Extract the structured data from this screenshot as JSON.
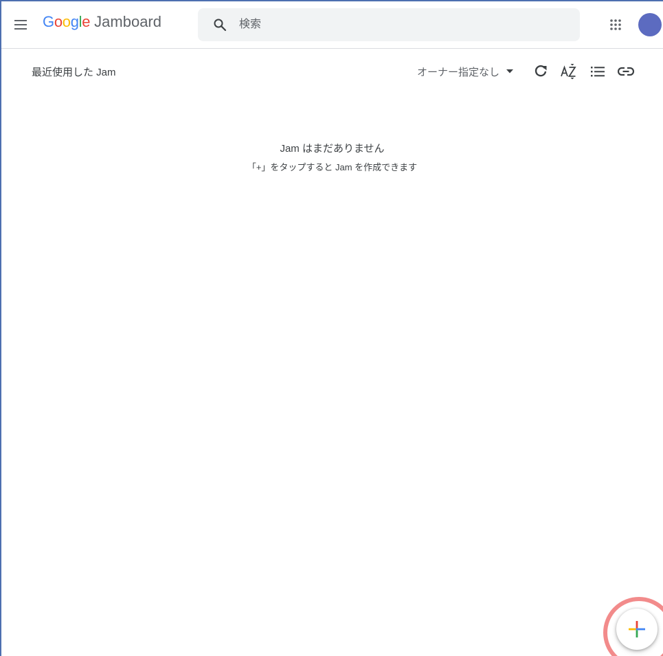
{
  "header": {
    "logo": {
      "letters": [
        {
          "char": "G",
          "color": "#4285F4"
        },
        {
          "char": "o",
          "color": "#EA4335"
        },
        {
          "char": "o",
          "color": "#FBBC05"
        },
        {
          "char": "g",
          "color": "#4285F4"
        },
        {
          "char": "l",
          "color": "#34A853"
        },
        {
          "char": "e",
          "color": "#EA4335"
        }
      ],
      "product": "Jamboard"
    },
    "search": {
      "placeholder": "検索",
      "value": ""
    },
    "icons": {
      "menu": "hamburger-menu-icon",
      "search": "search-icon",
      "apps": "apps-grid-icon"
    },
    "avatar_color": "#5c6bc0"
  },
  "toolbar": {
    "section_title": "最近使用した Jam",
    "owner_filter": "オーナー指定なし",
    "icons": [
      "dropdown-caret-icon",
      "refresh-icon",
      "sort-az-icon",
      "list-view-icon",
      "link-icon"
    ]
  },
  "empty_state": {
    "title": "Jam はまだありません",
    "hint": "「+」をタップすると Jam を作成できます"
  },
  "fab": {
    "icon": "plus-icon",
    "colors": {
      "top": "#EA4335",
      "right": "#4285F4",
      "bottom": "#34A853",
      "left": "#FBBC05"
    },
    "highlight_color": "#f28b8b"
  }
}
